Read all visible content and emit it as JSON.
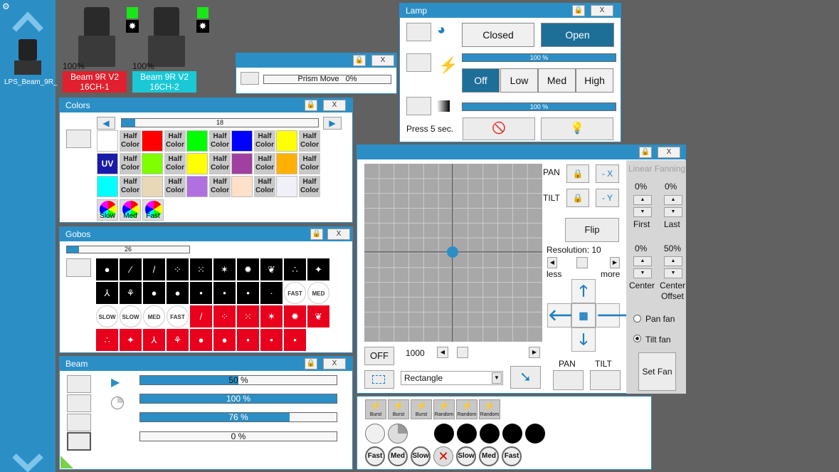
{
  "sidebar": {
    "device_label": "LPS_Beam_9R_"
  },
  "fixtures": [
    {
      "pct": "100%",
      "name": "Beam 9R V2",
      "mode": "16CH-1",
      "color": "#e0202e"
    },
    {
      "pct": "100%",
      "name": "Beam 9R V2",
      "mode": "16CH-2",
      "color": "#1bc8d6"
    }
  ],
  "prism": {
    "label": "Prism Move",
    "value": "0%"
  },
  "lamp": {
    "title": "Lamp",
    "closed": "Closed",
    "open": "Open",
    "bar1": "100 %",
    "off": "Off",
    "low": "Low",
    "med": "Med",
    "high": "High",
    "bar2": "100 %",
    "press": "Press 5 sec."
  },
  "colors": {
    "title": "Colors",
    "value": "18",
    "half": "Half Color",
    "uv": "UV",
    "slow": "Slow",
    "med": "Med",
    "fast": "Fast",
    "swatches": [
      "#ffffff",
      "#ff0000",
      "#00ff00",
      "#0000ff",
      "#ffff00",
      "#1a1aa8",
      "#7fff00",
      "#ffff00",
      "#a040a0",
      "#ffb000",
      "#00ffff",
      "#e8d8b8",
      "#b070e0",
      "#ffe0c8",
      "#f0f0f8"
    ]
  },
  "gobos": {
    "title": "Gobos",
    "value": "26",
    "fast": "FAST",
    "med": "MED",
    "slow": "SLOW"
  },
  "beam": {
    "title": "Beam",
    "b1": "50 %",
    "b2": "100 %",
    "b3": "76 %",
    "b4": "0 %",
    "v1": 0.5,
    "v2": 1.0,
    "v3": 0.76,
    "v4": 0
  },
  "pantilt": {
    "pan": "PAN",
    "tilt": "TILT",
    "minus_x": "- X",
    "minus_y": "- Y",
    "flip": "Flip",
    "resolution": "Resolution: 10",
    "less": "less",
    "more": "more",
    "off": "OFF",
    "speed": "1000",
    "shape": "Rectangle",
    "pan_label": "PAN",
    "tilt_label": "TILT"
  },
  "fanning": {
    "title": "Linear Fanning",
    "p1": "0%",
    "p2": "0%",
    "first": "First",
    "last": "Last",
    "p3": "0%",
    "p4": "50%",
    "center": "Center",
    "center_offset": "Center Offset",
    "pan_fan": "Pan fan",
    "tilt_fan": "Tilt fan",
    "set_fan": "Set Fan"
  },
  "strobe": {
    "burst": "Burst",
    "random": "Random",
    "fast": "Fast",
    "med": "Med",
    "slow": "Slow"
  }
}
